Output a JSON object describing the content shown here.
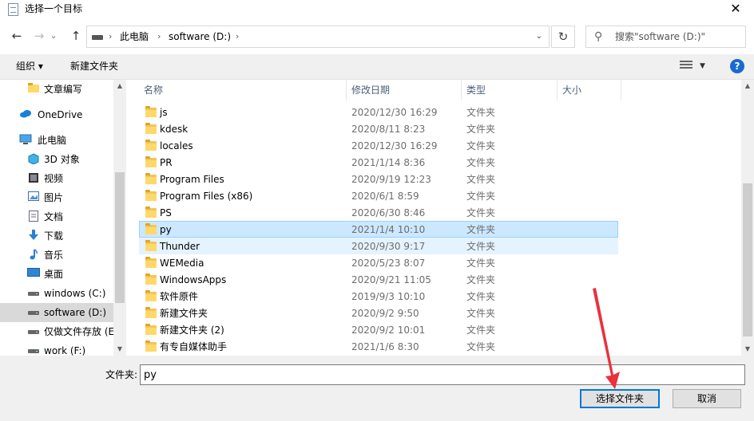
{
  "window": {
    "title": "选择一个目标",
    "close_glyph": "✕"
  },
  "nav": {
    "back_glyph": "←",
    "forward_glyph": "→",
    "recent_glyph": "⌄",
    "up_glyph": "↑",
    "breadcrumb": [
      "此电脑",
      "software (D:)"
    ],
    "sep_glyph": "›",
    "dropdown_glyph": "⌄",
    "refresh_glyph": "↻",
    "search_placeholder": "搜索\"software (D:)\""
  },
  "toolbar": {
    "organize_label": "组织 ▾",
    "new_folder_label": "新建文件夹",
    "view_dropdown_glyph": "▼",
    "help_glyph": "?"
  },
  "sidebar": {
    "scroll_up_glyph": "▲",
    "scroll_down_glyph": "▼",
    "items": [
      {
        "label": "文章编写",
        "icon": "folder-icon"
      },
      {
        "label": "OneDrive",
        "icon": "cloud-icon"
      },
      {
        "label": "此电脑",
        "icon": "computer-icon"
      },
      {
        "label": "3D 对象",
        "icon": "cube-icon"
      },
      {
        "label": "视频",
        "icon": "video-icon"
      },
      {
        "label": "图片",
        "icon": "picture-icon"
      },
      {
        "label": "文档",
        "icon": "document-icon"
      },
      {
        "label": "下载",
        "icon": "download-icon"
      },
      {
        "label": "音乐",
        "icon": "music-icon"
      },
      {
        "label": "桌面",
        "icon": "desktop-icon"
      },
      {
        "label": "windows (C:)",
        "icon": "drive-icon"
      },
      {
        "label": "software (D:)",
        "icon": "drive-icon",
        "selected": true
      },
      {
        "label": "仅做文件存放 (E",
        "icon": "drive-icon"
      },
      {
        "label": "work (F:)",
        "icon": "drive-icon"
      }
    ]
  },
  "columns": {
    "name": "名称",
    "date": "修改日期",
    "type": "类型",
    "size": "大小",
    "sort_glyph": "^"
  },
  "files": [
    {
      "name": "js",
      "date": "2020/12/30 16:29",
      "type": "文件夹"
    },
    {
      "name": "kdesk",
      "date": "2020/8/11 8:23",
      "type": "文件夹"
    },
    {
      "name": "locales",
      "date": "2020/12/30 16:29",
      "type": "文件夹"
    },
    {
      "name": "PR",
      "date": "2021/1/14 8:36",
      "type": "文件夹"
    },
    {
      "name": "Program Files",
      "date": "2020/9/19 12:23",
      "type": "文件夹"
    },
    {
      "name": "Program Files (x86)",
      "date": "2020/6/1 8:59",
      "type": "文件夹"
    },
    {
      "name": "PS",
      "date": "2020/6/30 8:46",
      "type": "文件夹"
    },
    {
      "name": "py",
      "date": "2021/1/4 10:10",
      "type": "文件夹",
      "selected": true
    },
    {
      "name": "Thunder",
      "date": "2020/9/30 9:17",
      "type": "文件夹",
      "hover": true
    },
    {
      "name": "WEMedia",
      "date": "2020/5/23 8:07",
      "type": "文件夹"
    },
    {
      "name": "WindowsApps",
      "date": "2020/9/21 11:05",
      "type": "文件夹"
    },
    {
      "name": "软件原件",
      "date": "2019/9/3 10:10",
      "type": "文件夹"
    },
    {
      "name": "新建文件夹",
      "date": "2020/9/2 9:50",
      "type": "文件夹"
    },
    {
      "name": "新建文件夹 (2)",
      "date": "2020/9/2 10:01",
      "type": "文件夹"
    },
    {
      "name": "有专自媒体助手",
      "date": "2021/1/6 8:30",
      "type": "文件夹"
    }
  ],
  "bottom": {
    "folder_label": "文件夹:",
    "folder_value": "py",
    "select_button": "选择文件夹",
    "cancel_button": "取消"
  },
  "colors": {
    "selection": "#cce8ff",
    "accent": "#0078d7",
    "annotation": "#e8323c"
  }
}
